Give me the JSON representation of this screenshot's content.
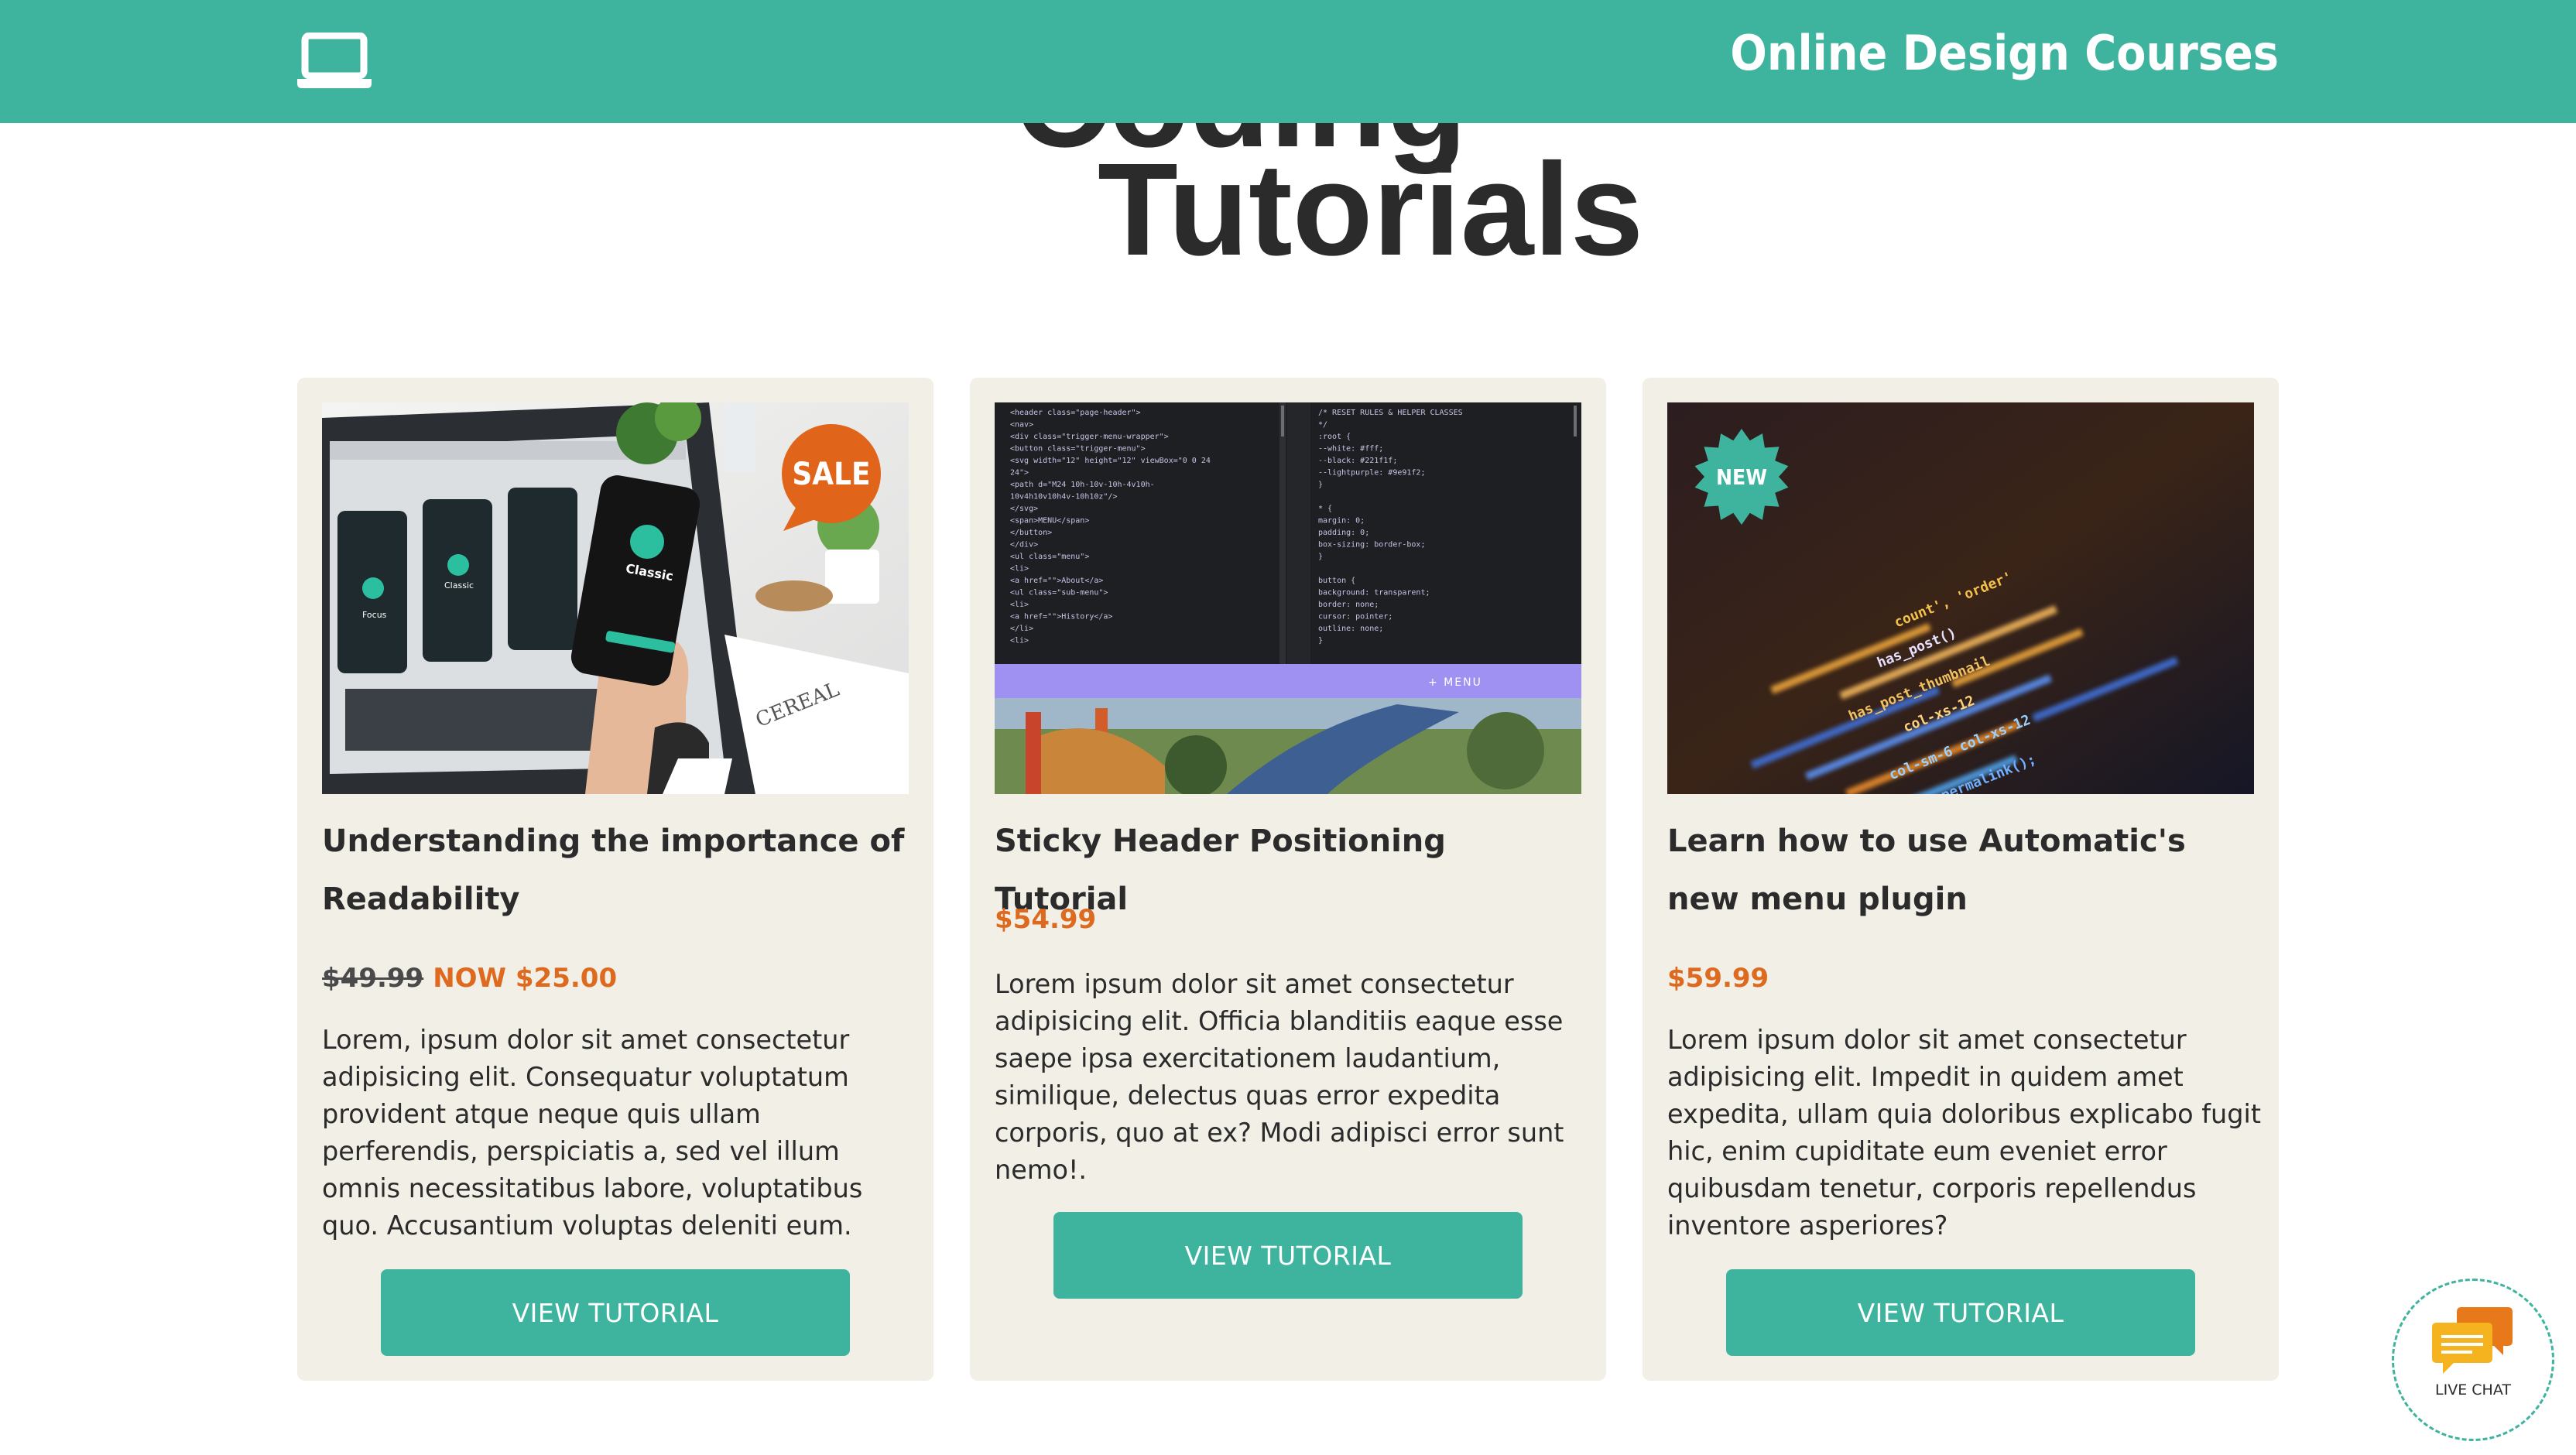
{
  "header": {
    "site_title": "Online Design Courses",
    "logo_icon": "laptop-icon",
    "bg_color": "#3eb49f"
  },
  "page": {
    "heading_line1": "Coding",
    "heading_line2": "Tutorials"
  },
  "cards": [
    {
      "badge": "SALE",
      "title": "Understanding the importance of Readability",
      "price_old": "$49.99",
      "price_now": "NOW $25.00",
      "description": "Lorem, ipsum dolor sit amet consectetur adipisicing elit. Consequatur voluptatum provident atque neque quis ullam perferendis, perspiciatis a, sed vel illum omnis necessitatibus labore, voluptatibus quo. Accusantium voluptas deleniti eum.",
      "button": "VIEW TUTORIAL",
      "phone_label": "Classic",
      "screen_labels": [
        "Focus",
        "Classic"
      ],
      "book_label": "CEREAL"
    },
    {
      "title": "Sticky Header Positioning Tutorial",
      "price": "$54.99",
      "description": "Lorem ipsum dolor sit amet consectetur adipisicing elit. Officia blanditiis eaque esse saepe ipsa exercitationem laudantium, similique, delectus quas error expedita corporis, quo at ex? Modi adipisci error sunt nemo!.",
      "button": "VIEW TUTORIAL",
      "menu_bar_label": "+ MENU",
      "code_left": [
        "<header class=\"page-header\">",
        "  <nav>",
        "    <div class=\"trigger-menu-wrapper\">",
        "      <button class=\"trigger-menu\">",
        "        <svg width=\"12\" height=\"12\" viewBox=\"0 0 24",
        "24\">",
        "          <path d=\"M24 10h-10v-10h-4v10h-",
        "10v4h10v10h4v-10h10z\"/>",
        "        </svg>",
        "        <span>MENU</span>",
        "      </button>",
        "    </div>",
        "    <ul class=\"menu\">",
        "      <li>",
        "        <a href=\"\">About</a>",
        "        <ul class=\"sub-menu\">",
        "          <li>",
        "            <a href=\"\">History</a>",
        "          </li>",
        "          <li>"
      ],
      "code_right": [
        "/* RESET RULES & HELPER CLASSES",
        "*/",
        ":root {",
        "  --white: #fff;",
        "  --black: #221f1f;",
        "  --lightpurple: #9e91f2;",
        "}",
        "",
        "* {",
        "  margin: 0;",
        "  padding: 0;",
        "  box-sizing: border-box;",
        "}",
        "",
        "button {",
        "  background: transparent;",
        "  border: none;",
        "  cursor: pointer;",
        "  outline: none;",
        "}"
      ]
    },
    {
      "badge": "NEW",
      "title": "Learn how to use Automatic's new menu plugin",
      "price": "$59.99",
      "description": "Lorem ipsum dolor sit amet consectetur adipisicing elit. Impedit in quidem amet expedita, ullam quia doloribus explicabo fugit hic, enim cupiditate eum eveniet error quibusdam tenetur, corporis repellendus inventore asperiores?",
      "button": "VIEW TUTORIAL",
      "code_fragments": [
        "count', 'order'",
        "has_post()",
        "has_post_thumbnail",
        "col-xs-12",
        "col-sm-6 col-xs-12",
        "he_permalink();"
      ]
    }
  ],
  "live_chat": {
    "label": "LIVE CHAT",
    "icon": "chat-bubbles-icon"
  },
  "colors": {
    "accent": "#3eb49f",
    "price": "#dd6a1e",
    "card_bg": "#f2efe7",
    "badge_sale": "#e0641a"
  }
}
